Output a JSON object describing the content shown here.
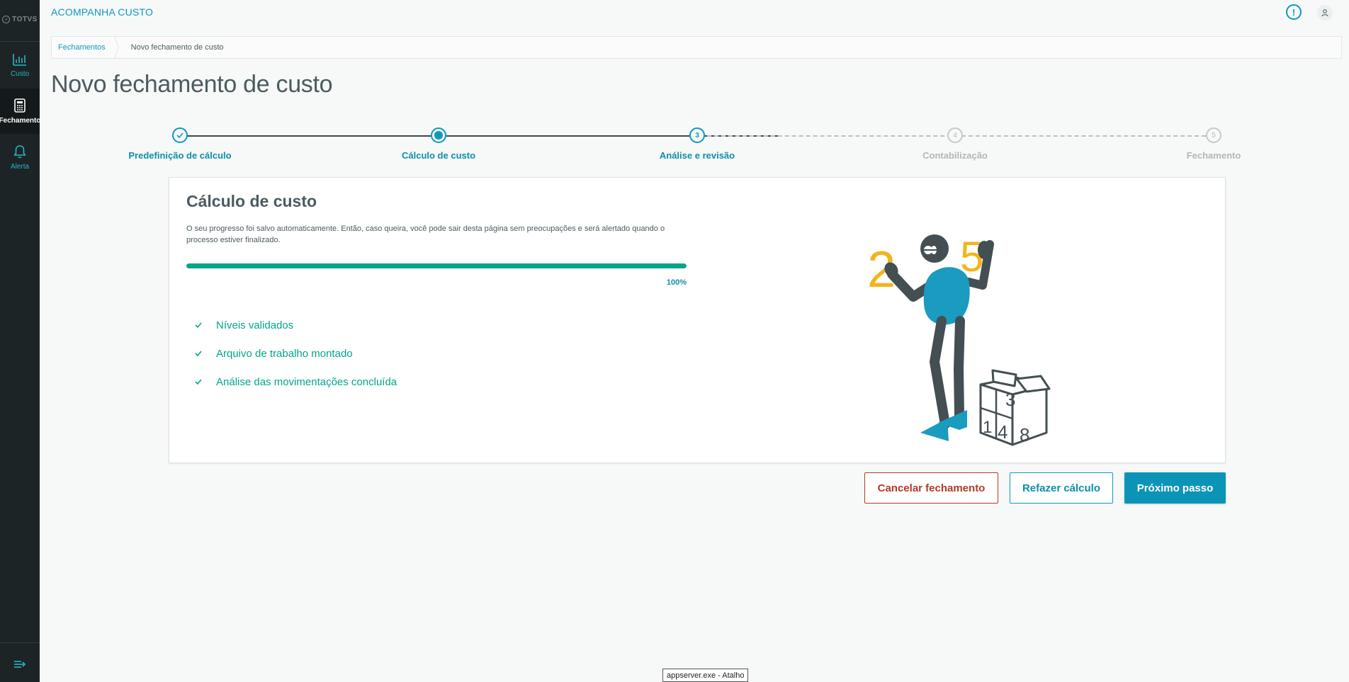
{
  "sidebar": {
    "logo_text": "TOTVS",
    "items": [
      {
        "label": "Custo",
        "icon": "bar-chart-icon"
      },
      {
        "label": "Fechamento",
        "icon": "calculator-icon",
        "active": true
      },
      {
        "label": "Alerta",
        "icon": "bell-icon"
      }
    ],
    "collapse_icon": "collapse-menu-icon"
  },
  "header": {
    "title": "ACOMPANHA CUSTO",
    "alert_icon": "alert-icon",
    "alert_glyph": "!",
    "user_icon": "user-icon"
  },
  "breadcrumb": {
    "items": [
      "Fechamentos",
      "Novo fechamento de custo"
    ]
  },
  "page": {
    "title": "Novo fechamento de custo"
  },
  "stepper": {
    "steps": [
      {
        "label": "Predefinição de cálculo",
        "state": "done",
        "number": ""
      },
      {
        "label": "Cálculo de custo",
        "state": "current",
        "number": ""
      },
      {
        "label": "Análise e revisão",
        "state": "next",
        "number": "3"
      },
      {
        "label": "Contabilização",
        "state": "todo",
        "number": "4"
      },
      {
        "label": "Fechamento",
        "state": "todo",
        "number": "5"
      }
    ]
  },
  "card": {
    "title": "Cálculo de custo",
    "description": "O seu progresso foi salvo automaticamente. Então, caso queira, você pode sair desta página sem preocupações e será alertado quando o processo estiver finalizado.",
    "progress_value": 1.0,
    "progress_label": "100%",
    "tasks": [
      "Níveis validados",
      "Arquivo de trabalho montado",
      "Análise das movimentações concluída"
    ],
    "illustration_numbers": [
      "2",
      "5",
      "3",
      "1",
      "4",
      "8"
    ]
  },
  "actions": {
    "cancel": "Cancelar fechamento",
    "redo": "Refazer cálculo",
    "next": "Próximo passo"
  },
  "tooltip": {
    "text": "appserver.exe - Atalho"
  },
  "colors": {
    "primary": "#0c9abe",
    "success": "#00a689",
    "danger": "#b33a25",
    "sidebar": "#1d2426",
    "illustration_yellow": "#f2b51c",
    "illustration_blue": "#1a9bc0"
  }
}
